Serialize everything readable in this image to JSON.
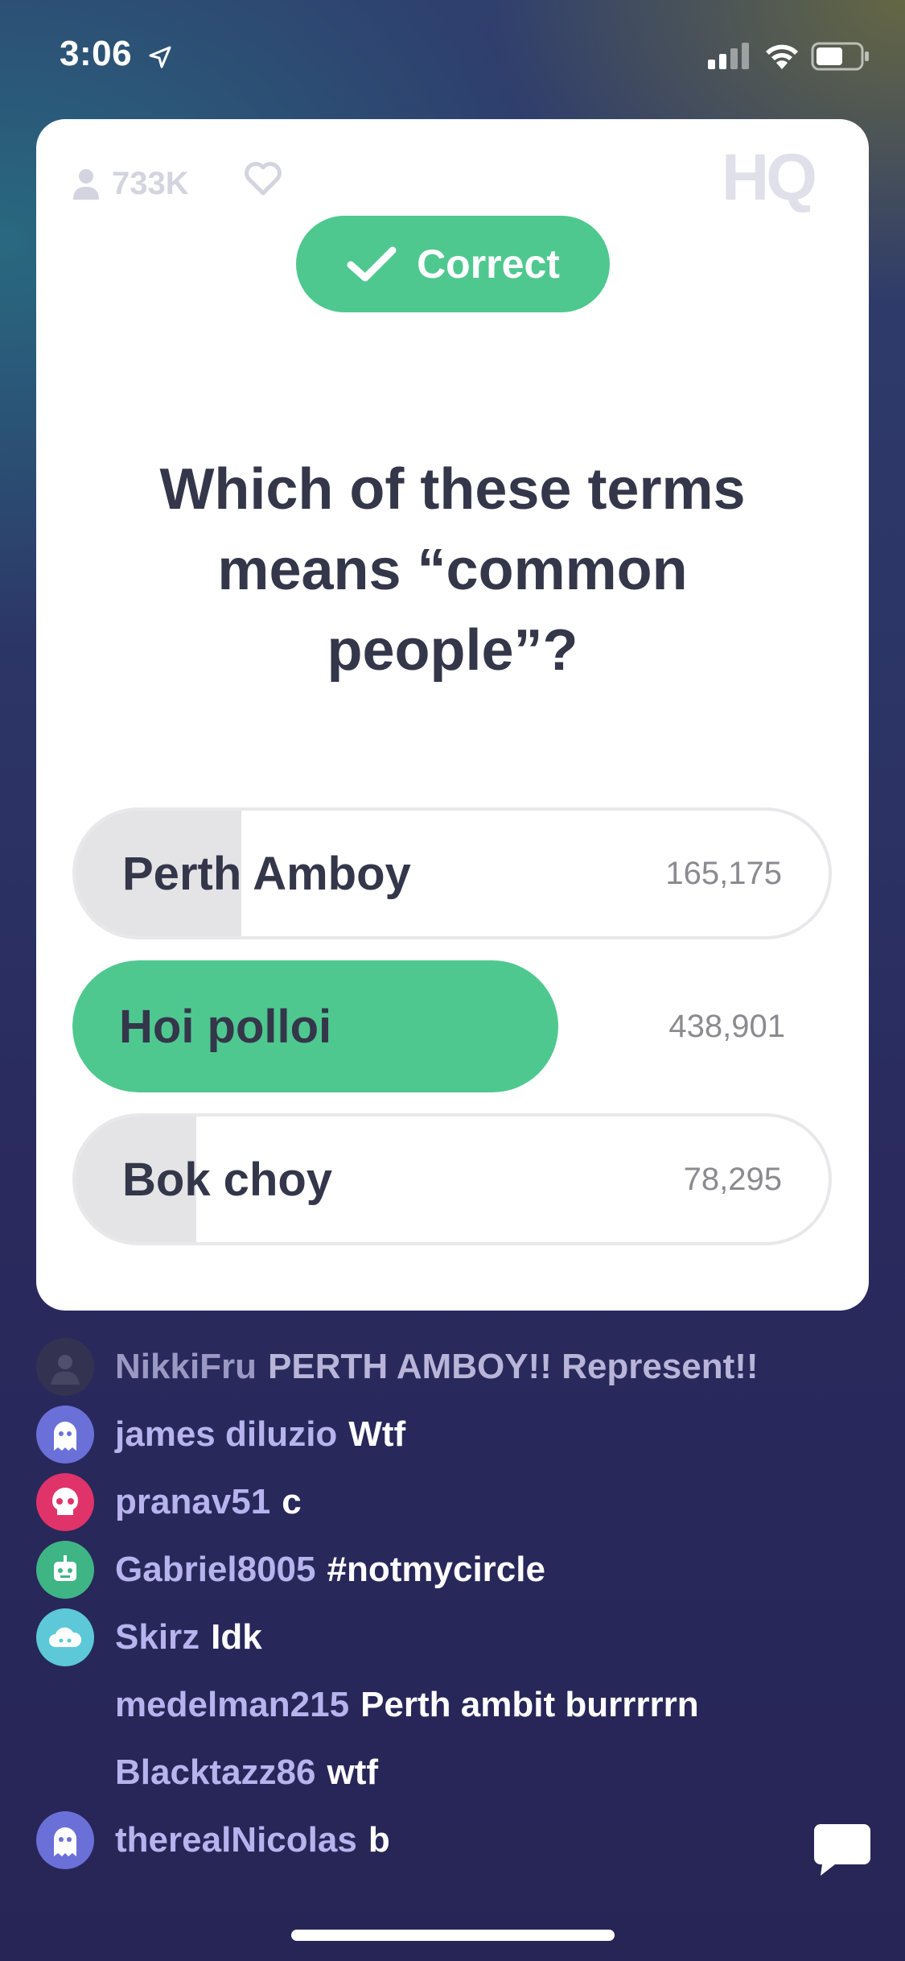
{
  "status_bar": {
    "time": "3:06",
    "location_icon": "location-arrow-icon",
    "signal_icon": "cellular-signal-icon",
    "wifi_icon": "wifi-icon",
    "battery_icon": "battery-icon"
  },
  "card": {
    "viewer_count": "733K",
    "user_icon": "person-icon",
    "heart_icon": "heart-icon",
    "logo_text": "HQ",
    "result_label": "Correct",
    "question": "Which of these terms means “common people”?",
    "answers": [
      {
        "label": "Perth Amboy",
        "count": "165,175",
        "fill_fraction": 0.22,
        "selected": false
      },
      {
        "label": "Hoi polloi",
        "count": "438,901",
        "fill_fraction": 0.64,
        "selected": true
      },
      {
        "label": "Bok choy",
        "count": "78,295",
        "fill_fraction": 0.16,
        "selected": false
      }
    ]
  },
  "chat": [
    {
      "user": "NikkiFru",
      "message": "PERTH AMBOY!! Represent!!",
      "avatar": "photo-avatar",
      "avatar_color": "#3a3a4a"
    },
    {
      "user": "james diluzio",
      "message": "Wtf",
      "avatar": "ghost-icon",
      "avatar_color": "#6a70d8"
    },
    {
      "user": "pranav51",
      "message": "c",
      "avatar": "skull-icon",
      "avatar_color": "#e0336a"
    },
    {
      "user": "Gabriel8005",
      "message": "#notmycircle",
      "avatar": "robot-icon",
      "avatar_color": "#3fb585"
    },
    {
      "user": "Skirz",
      "message": "Idk",
      "avatar": "cloud-icon",
      "avatar_color": "#5cc8d8"
    },
    {
      "user": "medelman215",
      "message": "Perth ambit burrrrrn",
      "avatar": ""
    },
    {
      "user": "Blacktazz86",
      "message": "wtf",
      "avatar": ""
    },
    {
      "user": "therealNicolas",
      "message": "b",
      "avatar": "ghost-icon",
      "avatar_color": "#6a70d8"
    }
  ],
  "chat_bubble_icon": "chat-bubble-icon",
  "colors": {
    "correct_green": "#4fc890",
    "question_text": "#34364a",
    "chat_username": "#b7b3ee"
  }
}
